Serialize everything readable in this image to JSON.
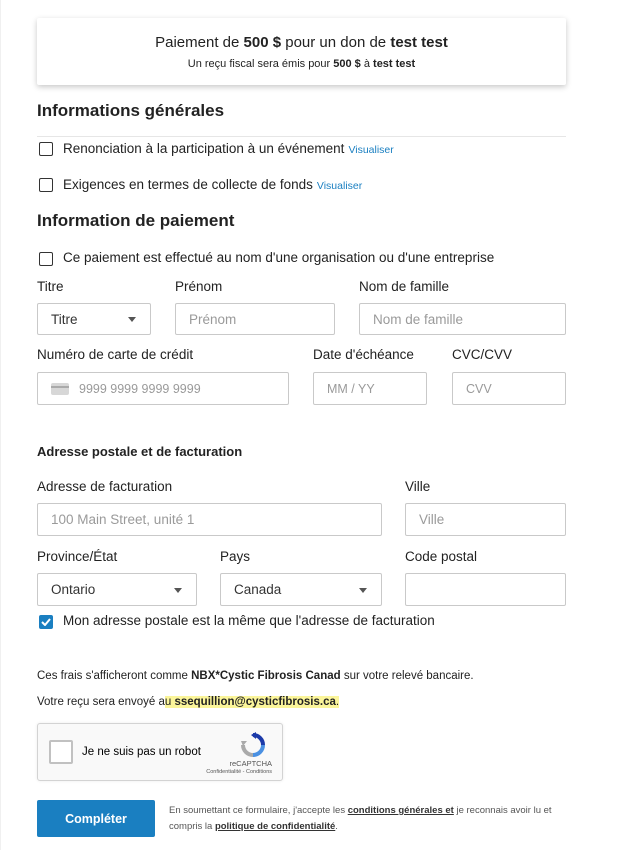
{
  "summary": {
    "line1_prefix": "Paiement de ",
    "amount": "500 $",
    "line1_middle": " pour un don de ",
    "donor": "test test",
    "line2_prefix": "Un reçu fiscal sera émis pour ",
    "line2_amount": "500 $",
    "line2_middle": " à ",
    "line2_name": "test test"
  },
  "general": {
    "title": "Informations générales",
    "waiver_label": "Renonciation à la participation à un événement",
    "waiver_link": "Visualiser",
    "fundraising_label": "Exigences en termes de collecte de fonds",
    "fundraising_link": "Visualiser"
  },
  "payment": {
    "title": "Information de paiement",
    "org_label": "Ce paiement est effectué au nom d'une organisation ou d'une entreprise",
    "title_label": "Titre",
    "title_value": "Titre",
    "firstname_label": "Prénom",
    "firstname_placeholder": "Prénom",
    "lastname_label": "Nom de famille",
    "lastname_placeholder": "Nom de famille",
    "card_label": "Numéro de carte de crédit",
    "card_placeholder": "9999 9999 9999 9999",
    "expiry_label": "Date d'échéance",
    "expiry_placeholder": "MM / YY",
    "cvc_label": "CVC/CVV",
    "cvc_placeholder": "CVV"
  },
  "address": {
    "title": "Adresse postale et de facturation",
    "billing_label": "Adresse de facturation",
    "billing_placeholder": "100 Main Street, unité 1",
    "city_label": "Ville",
    "city_placeholder": "Ville",
    "province_label": "Province/État",
    "province_value": "Ontario",
    "country_label": "Pays",
    "country_value": "Canada",
    "postal_label": "Code postal",
    "postal_value": "",
    "same_address_label": "Mon adresse postale est la même que l'adresse de facturation"
  },
  "info": {
    "charge_prefix": "Ces frais s'afficheront comme ",
    "charge_name": "NBX*Cystic Fibrosis Canad",
    "charge_suffix": " sur votre relevé bancaire.",
    "receipt_prefix": "Votre reçu sera envoyé a",
    "receipt_highlight_prefix": "u ",
    "receipt_email": "ssequillion@cysticfibrosis.ca",
    "receipt_suffix": "."
  },
  "captcha": {
    "label": "Je ne suis pas un robot",
    "brand": "reCAPTCHA",
    "links": "Confidentialité - Conditions"
  },
  "submit": {
    "label": "Compléter",
    "terms_prefix": "En soumettant ce formulaire, j'accepte les ",
    "terms_link": "conditions générales et",
    "terms_middle": " je reconnais avoir lu et",
    "terms_line2_prefix": "compris la ",
    "privacy_link": "politique de confidentialité",
    "terms_suffix": "."
  },
  "colors": {
    "accent": "#1a7fc1",
    "highlight": "#fbf59a"
  }
}
